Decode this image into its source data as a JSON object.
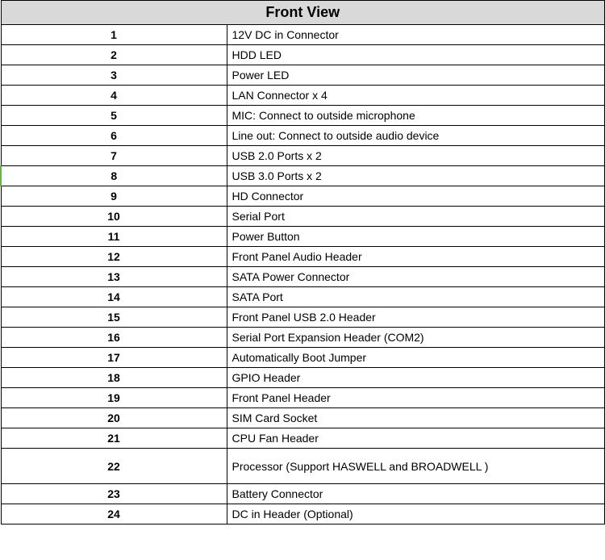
{
  "table": {
    "title": "Front View",
    "rows": [
      {
        "num": "1",
        "desc": "12V DC in Connector"
      },
      {
        "num": "2",
        "desc": "HDD LED"
      },
      {
        "num": "3",
        "desc": "Power LED"
      },
      {
        "num": "4",
        "desc": "LAN Connector x 4"
      },
      {
        "num": "5",
        "desc": "MIC: Connect to outside microphone"
      },
      {
        "num": "6",
        "desc": "Line out: Connect to outside audio device"
      },
      {
        "num": "7",
        "desc": "USB 2.0 Ports x 2"
      },
      {
        "num": "8",
        "desc": "USB 3.0 Ports x 2"
      },
      {
        "num": "9",
        "desc": "HD Connector"
      },
      {
        "num": "10",
        "desc": "Serial Port"
      },
      {
        "num": "11",
        "desc": "Power Button"
      },
      {
        "num": "12",
        "desc": "Front Panel Audio Header"
      },
      {
        "num": "13",
        "desc": "SATA Power Connector"
      },
      {
        "num": "14",
        "desc": "SATA Port"
      },
      {
        "num": "15",
        "desc": "Front Panel USB 2.0 Header"
      },
      {
        "num": "16",
        "desc": "Serial Port Expansion Header (COM2)"
      },
      {
        "num": "17",
        "desc": "Automatically Boot Jumper"
      },
      {
        "num": "18",
        "desc": "GPIO Header"
      },
      {
        "num": "19",
        "desc": "Front Panel Header"
      },
      {
        "num": "20",
        "desc": "SIM Card Socket"
      },
      {
        "num": "21",
        "desc": "CPU Fan Header"
      },
      {
        "num": "22",
        "desc": "Processor (Support HASWELL and BROADWELL )"
      },
      {
        "num": "23",
        "desc": "Battery Connector"
      },
      {
        "num": "24",
        "desc": "DC in Header (Optional)"
      }
    ]
  }
}
